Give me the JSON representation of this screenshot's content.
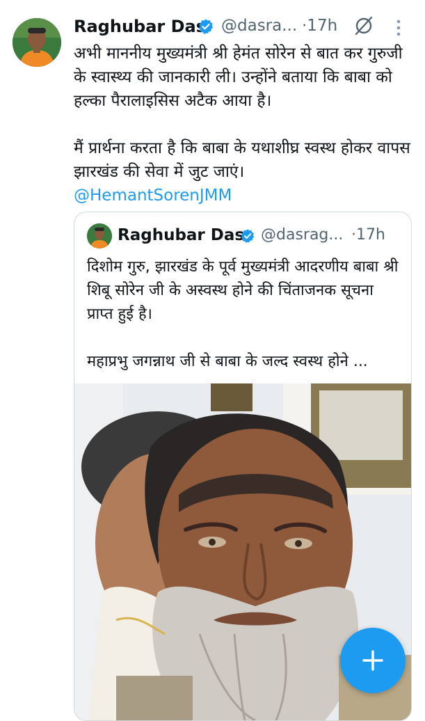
{
  "tweet": {
    "author_name": "Raghubar Das",
    "handle": "@dasra...",
    "time": "·17h",
    "text_p1": "अभी माननीय मुख्यमंत्री श्री हेमंत सोरेन से बात कर गुरुजी के स्वास्थ्य की जानकारी ली। उन्होंने बताया कि बाबा को हल्का पैरालाइसिस अटैक आया है।",
    "text_p2": "मैं प्रार्थना करता है कि बाबा के यथाशीघ्र स्वस्थ होकर वापस झारखंड की सेवा में जुट जाएं।",
    "mention": "@HemantSorenJMM"
  },
  "quoted_tweet": {
    "author_name": "Raghubar Das",
    "handle": "@dasrag...",
    "time": "·17h",
    "text_p1": "दिशोम गुरु, झारखंड के पूर्व मुख्यमंत्री आदरणीय बाबा श्री शिबू सोरेन जी के अस्वस्थ होने की चिंताजनक सूचना प्राप्त हुई है।",
    "text_p2": "महाप्रभु जगन्नाथ जी से बाबा के जल्द स्वस्थ होने ..."
  },
  "icons": {
    "verified": "verified-badge-icon",
    "grok": "grok-icon",
    "more": "more-vertical-icon",
    "compose": "plus-icon"
  },
  "colors": {
    "accent": "#1d9bf0",
    "text_primary": "#0f1419",
    "text_secondary": "#536471",
    "border": "#cfd9de"
  }
}
